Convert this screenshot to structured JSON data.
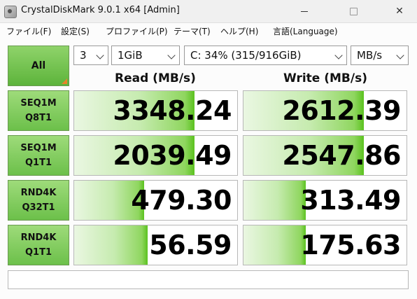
{
  "window": {
    "title": "CrystalDiskMark 9.0.1 x64 [Admin]"
  },
  "menu": [
    "ファイル(F)",
    "設定(S)",
    "プロファイル(P)",
    "テーマ(T)",
    "ヘルプ(H)",
    "言語(Language)"
  ],
  "controls": {
    "all_label": "All",
    "count": "3",
    "size": "1GiB",
    "drive": "C: 34% (315/916GiB)",
    "unit": "MB/s"
  },
  "headers": {
    "read": "Read (MB/s)",
    "write": "Write (MB/s)"
  },
  "rows": [
    {
      "l1": "SEQ1M",
      "l2": "Q8T1",
      "read": "3348.24",
      "write": "2612.39",
      "read_fill": 0.74,
      "write_fill": 0.74
    },
    {
      "l1": "SEQ1M",
      "l2": "Q1T1",
      "read": "2039.49",
      "write": "2547.86",
      "read_fill": 0.74,
      "write_fill": 0.74
    },
    {
      "l1": "RND4K",
      "l2": "Q32T1",
      "read": "479.30",
      "write": "313.49",
      "read_fill": 0.43,
      "write_fill": 0.38
    },
    {
      "l1": "RND4K",
      "l2": "Q1T1",
      "read": "56.59",
      "write": "175.63",
      "read_fill": 0.45,
      "write_fill": 0.38
    }
  ],
  "status": {
    "text": ""
  },
  "colors": {
    "accent_green": "#5bc21f",
    "corner_orange": "#e8832a"
  }
}
